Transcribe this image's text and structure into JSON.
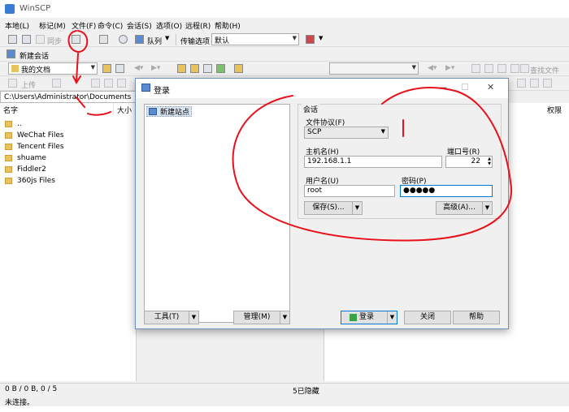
{
  "window": {
    "title": "WinSCP"
  },
  "menu": [
    "本地(L)",
    "标记(M)",
    "文件(F)",
    "命令(C)",
    "会话(S)",
    "选项(O)",
    "远程(R)",
    "帮助(H)"
  ],
  "toolbar": {
    "sync_label": "同步",
    "queue_label": "队列",
    "transfer_options_label": "传输选项",
    "transfer_options_value": "默认",
    "new_session_label": "新建会话",
    "local_dir": "我的文档",
    "upload_label": "上传",
    "find_files_label": "查找文件"
  },
  "local": {
    "path": "C:\\Users\\Administrator\\Documents",
    "columns": [
      "名字",
      "大小"
    ],
    "files": [
      "..",
      "WeChat Files",
      "Tencent Files",
      "shuame",
      "Fiddler2",
      "360js Files"
    ]
  },
  "remote": {
    "columns": [
      "权限"
    ]
  },
  "status": {
    "bytes": "0 B / 0 B,  0 / 5",
    "hidden": "5已隐藏",
    "connection": "未连接。"
  },
  "dialog": {
    "title": "登录",
    "tree_item": "新建站点",
    "session_group": "会话",
    "protocol_label": "文件协议(F)",
    "protocol_value": "SCP",
    "host_label": "主机名(H)",
    "host_value": "192.168.1.1",
    "port_label": "端口号(R)",
    "port_value": "22",
    "user_label": "用户名(U)",
    "user_value": "root",
    "password_label": "密码(P)",
    "password_value": "●●●●●",
    "save_label": "保存(S)...",
    "advanced_label": "高级(A)...",
    "tools_label": "工具(T)",
    "manage_label": "管理(M)",
    "login_label": "登录",
    "close_label": "关闭",
    "help_label": "帮助"
  },
  "colors": {
    "annotation": "#e8101a",
    "accent": "#0078d7",
    "folder": "#e8c25a"
  }
}
